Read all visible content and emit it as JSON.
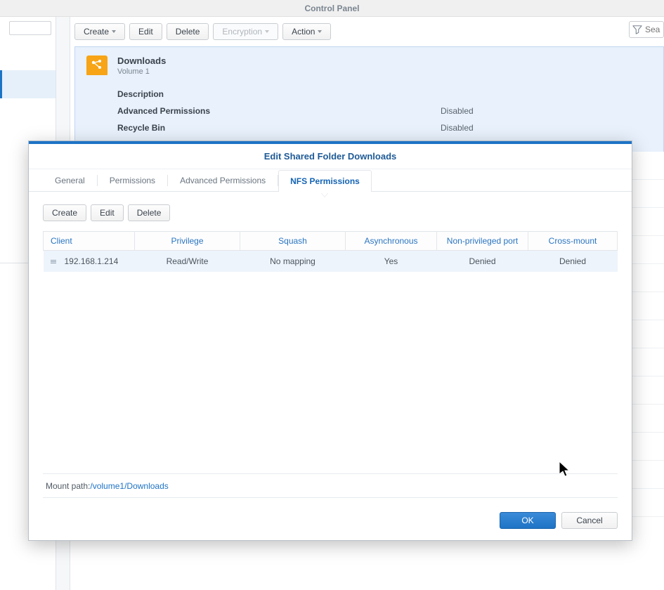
{
  "header": {
    "title": "Control Panel"
  },
  "toolbar": {
    "create": "Create",
    "edit": "Edit",
    "delete": "Delete",
    "encryption": "Encryption",
    "action": "Action"
  },
  "search": {
    "placeholder": "Sea"
  },
  "folder": {
    "name": "Downloads",
    "volume": "Volume 1",
    "rows": {
      "desc_label": "Description",
      "desc_value": "",
      "adv_label": "Advanced Permissions",
      "adv_value": "Disabled",
      "bin_label": "Recycle Bin",
      "bin_value": "Disabled"
    }
  },
  "modal": {
    "title": "Edit Shared Folder Downloads",
    "tabs": {
      "general": "General",
      "permissions": "Permissions",
      "advanced": "Advanced Permissions",
      "nfs": "NFS Permissions"
    },
    "toolbar": {
      "create": "Create",
      "edit": "Edit",
      "delete": "Delete"
    },
    "columns": {
      "client": "Client",
      "privilege": "Privilege",
      "squash": "Squash",
      "async": "Asynchronous",
      "nonpriv": "Non-privileged port",
      "cross": "Cross-mount"
    },
    "rows": [
      {
        "client": "192.168.1.214",
        "privilege": "Read/Write",
        "squash": "No mapping",
        "async": "Yes",
        "nonpriv": "Denied",
        "cross": "Denied"
      }
    ],
    "mount_label": "Mount path:",
    "mount_path": "/volume1/Downloads",
    "ok": "OK",
    "cancel": "Cancel"
  }
}
